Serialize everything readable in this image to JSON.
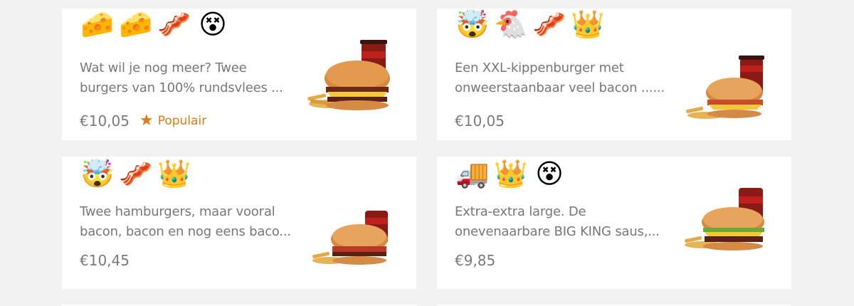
{
  "cards": [
    {
      "emojis": [
        "🧀",
        "🧀",
        "🥓",
        "😵"
      ],
      "description": "Wat wil je nog meer? Twee burgers van 100% rundsvlees ...",
      "price": "€10,05",
      "badge": "Populair"
    },
    {
      "emojis": [
        "🤯",
        "🐔",
        "🥓",
        "👑"
      ],
      "description": "Een XXL-kippenburger met onweerstaanbaar veel bacon ......",
      "price": "€10,05",
      "badge": ""
    },
    {
      "emojis": [
        "🤯",
        "🥓",
        "👑"
      ],
      "description": "Twee hamburgers, maar vooral bacon, bacon en nog eens baco...",
      "price": "€10,45",
      "badge": ""
    },
    {
      "emojis": [
        "🚚",
        "👑",
        "😵"
      ],
      "description": "Extra-extra large. De onevenaarbare BIG KING saus,...",
      "price": "€9,85",
      "badge": ""
    }
  ],
  "colors": {
    "background": "#f2f2f2",
    "card": "#ffffff",
    "text": "#777777",
    "price": "#7a7a7a",
    "accent": "#e07b12"
  },
  "icons": {
    "popular": "star-icon",
    "product": "burger-meal-image"
  }
}
